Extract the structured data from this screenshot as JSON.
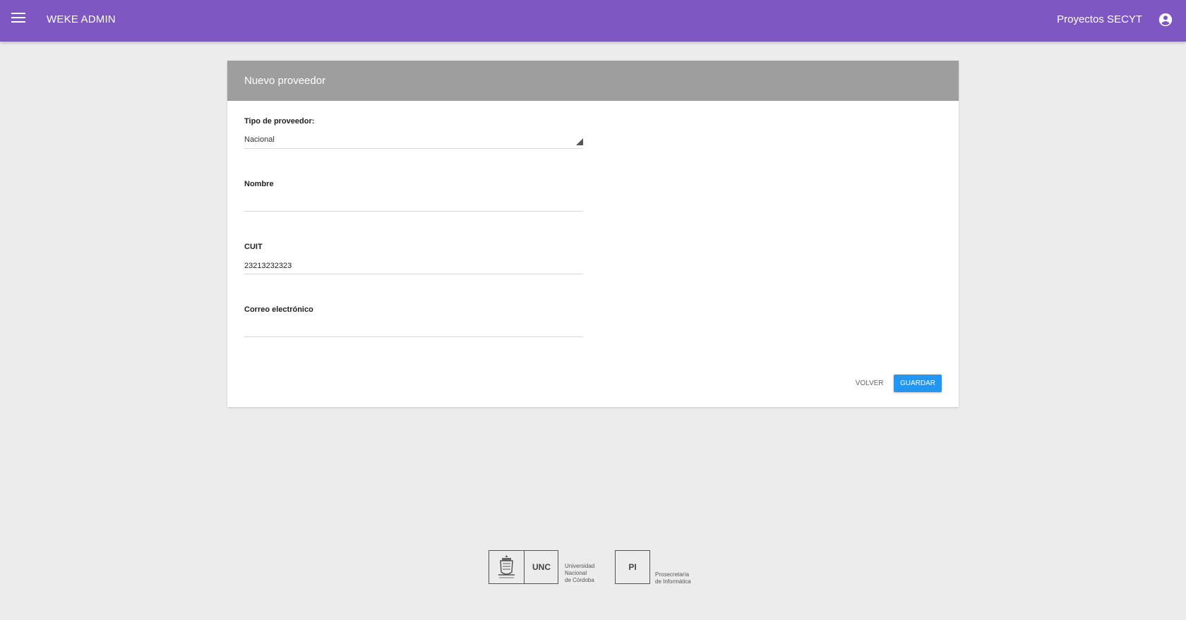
{
  "header": {
    "app_title": "WEKE ADMIN",
    "project": "Proyectos SECYT",
    "menu_icon": "menu-icon",
    "account_icon": "account-circle-icon",
    "bar_color": "#7e57c2"
  },
  "form": {
    "title": "Nuevo proveedor",
    "fields": {
      "tipo": {
        "label": "Tipo de proveedor:",
        "value": "Nacional"
      },
      "nombre": {
        "label": "Nombre",
        "value": ""
      },
      "cuit": {
        "label": "CUIT",
        "value": "23213232323"
      },
      "correo": {
        "label": "Correo electrónico",
        "value": ""
      }
    },
    "actions": {
      "back": "VOLVER",
      "save": "GUARDAR"
    },
    "save_color": "#2196f3"
  },
  "footer": {
    "unc": {
      "abbr": "UNC",
      "line1": "Universidad",
      "line2": "Nacional",
      "line3": "de Córdoba"
    },
    "pi": {
      "abbr": "PI",
      "line1": "Prosecretaría",
      "line2": "de Informática"
    }
  }
}
